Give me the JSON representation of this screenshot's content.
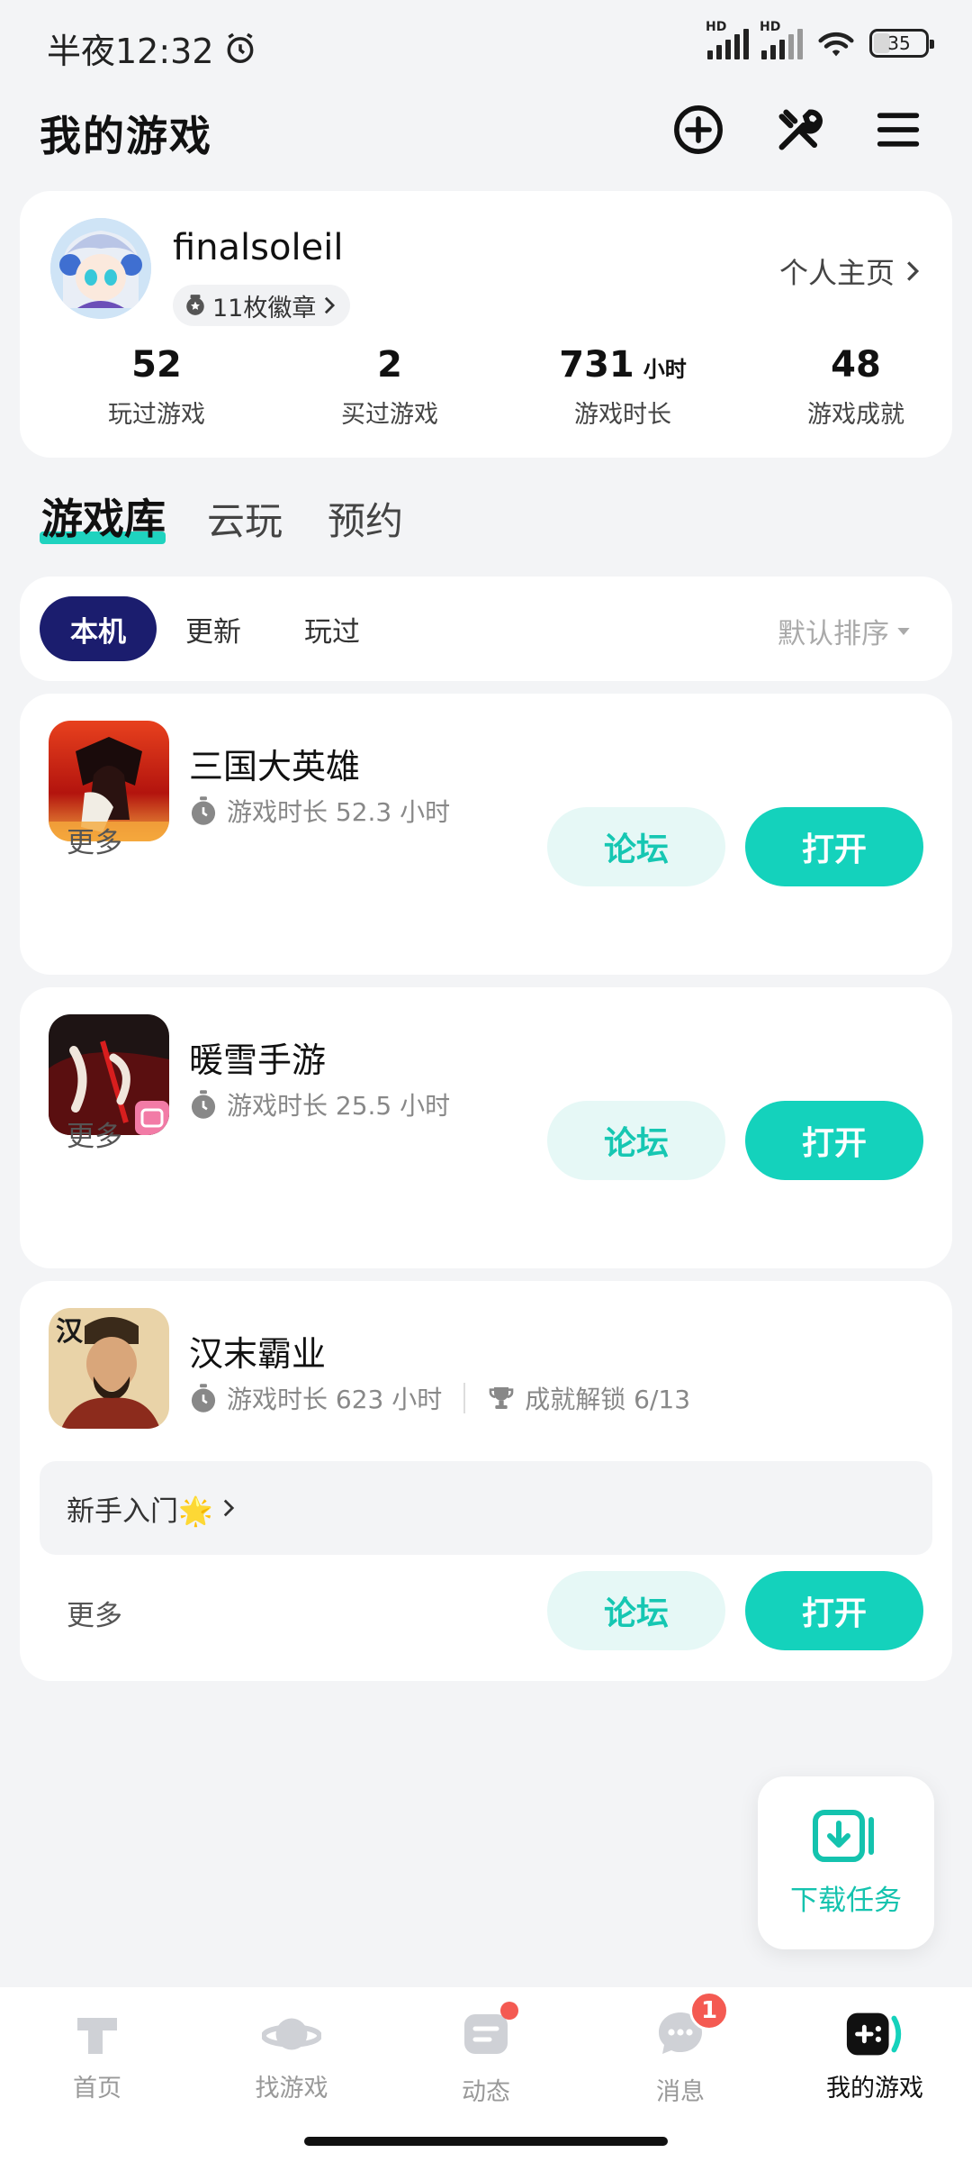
{
  "status_bar": {
    "time": "半夜12:32",
    "battery": "35",
    "hd": "HD"
  },
  "header": {
    "title": "我的游戏",
    "icons": [
      "add-circle-icon",
      "tools-icon",
      "menu-icon"
    ]
  },
  "profile": {
    "username": "finalsoleil",
    "badges": "11枚徽章",
    "homepage_link": "个人主页",
    "stats": [
      {
        "value": "52",
        "unit": "",
        "label": "玩过游戏"
      },
      {
        "value": "2",
        "unit": "",
        "label": "买过游戏"
      },
      {
        "value": "731",
        "unit": "小时",
        "label": "游戏时长"
      },
      {
        "value": "48",
        "unit": "",
        "label": "游戏成就"
      }
    ]
  },
  "tabs": [
    "游戏库",
    "云玩",
    "预约"
  ],
  "filters": {
    "chips": [
      "本机",
      "更新",
      "玩过"
    ],
    "sort": "默认排序"
  },
  "games": [
    {
      "name": "三国大英雄",
      "playtime": "游戏时长 52.3 小时",
      "more": "更多",
      "forum": "论坛",
      "open": "打开"
    },
    {
      "name": "暖雪手游",
      "playtime": "游戏时长 25.5 小时",
      "more": "更多",
      "forum": "论坛",
      "open": "打开"
    },
    {
      "name": "汉末霸业",
      "playtime": "游戏时长 623 小时",
      "achievement": "成就解锁 6/13",
      "guide": "新手入门🌟",
      "more": "更多",
      "forum": "论坛",
      "open": "打开"
    }
  ],
  "download_task": "下载任务",
  "bottom_nav": {
    "items": [
      "首页",
      "找游戏",
      "动态",
      "消息",
      "我的游戏"
    ],
    "message_badge": "1"
  },
  "colors": {
    "accent": "#14d2bc",
    "navy": "#1b1d6e",
    "badge_red": "#f45a52"
  }
}
